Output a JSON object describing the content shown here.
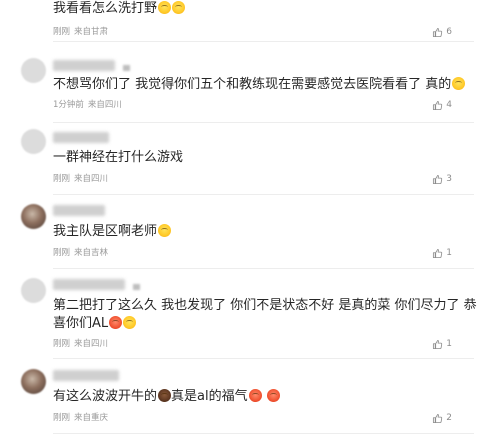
{
  "comments": [
    {
      "text": "我看看怎么洗打野",
      "emojis": [
        "grin-emoji",
        "grin-emoji"
      ],
      "time": "刚刚",
      "location": "来自甘肃",
      "likes": "6"
    },
    {
      "text": "不想骂你们了 我觉得你们五个和教练现在需要感觉去医院看看了 真的",
      "emojis": [
        "tongue-emoji"
      ],
      "time": "1分钟前",
      "location": "来自四川",
      "likes": "4"
    },
    {
      "text": "一群神经在打什么游戏",
      "emojis": [],
      "time": "刚刚",
      "location": "来自四川",
      "likes": "3"
    },
    {
      "text": "我主队是区啊老师",
      "emojis": [
        "sweat-smile-emoji"
      ],
      "time": "刚刚",
      "location": "来自吉林",
      "likes": "1"
    },
    {
      "text": "第二把打了这么久 我也发现了 你们不是状态不好 是真的菜 你们尽力了 恭喜你们AL",
      "emojis": [
        "kiss-emoji",
        "grin-emoji"
      ],
      "time": "刚刚",
      "location": "来自四川",
      "likes": "1"
    },
    {
      "text_before": "有这么波波开牛的",
      "text_after": "真是al的福气",
      "emojis_mid": [
        "poop-emoji"
      ],
      "emojis_end": [
        "heart-eyes-emoji",
        "heart-eyes-emoji"
      ],
      "time": "刚刚",
      "location": "来自重庆",
      "likes": "2"
    }
  ],
  "icons": {
    "like": "thumbs-up-icon"
  },
  "colors": {
    "text": "#262626",
    "meta": "#9a9a9a",
    "divider": "#ededed"
  }
}
